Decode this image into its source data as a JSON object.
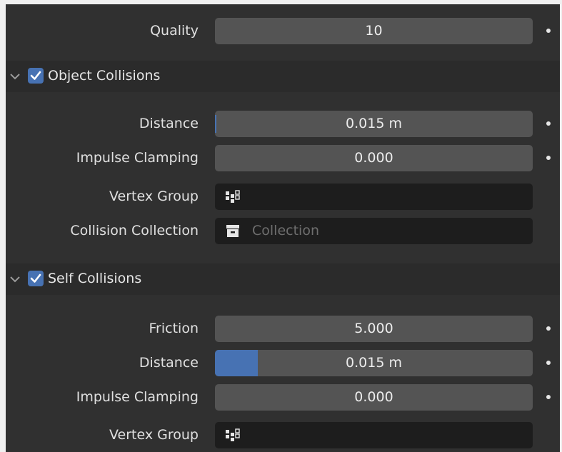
{
  "quality": {
    "label": "Quality",
    "value": "10"
  },
  "object_collisions": {
    "title": "Object Collisions",
    "enabled": true,
    "distance": {
      "label": "Distance",
      "value": "0.015 m"
    },
    "impulse_clamping": {
      "label": "Impulse Clamping",
      "value": "0.000"
    },
    "vertex_group": {
      "label": "Vertex Group",
      "value": ""
    },
    "collision_collection": {
      "label": "Collision Collection",
      "placeholder": "Collection"
    }
  },
  "self_collisions": {
    "title": "Self Collisions",
    "enabled": true,
    "friction": {
      "label": "Friction",
      "value": "5.000"
    },
    "distance": {
      "label": "Distance",
      "value": "0.015 m",
      "slider_fraction": 0.135
    },
    "impulse_clamping": {
      "label": "Impulse Clamping",
      "value": "0.000"
    },
    "vertex_group": {
      "label": "Vertex Group",
      "value": ""
    }
  },
  "colors": {
    "accent": "#4772b3",
    "field": "#545454",
    "field_dark": "#1d1d1d",
    "panel": "#303030"
  },
  "icons": {
    "expand": "chevron-down-icon",
    "check": "checkmark-icon",
    "vertex_group": "vertex-group-icon",
    "collection": "collection-box-icon",
    "keyframe": "dot-icon"
  }
}
